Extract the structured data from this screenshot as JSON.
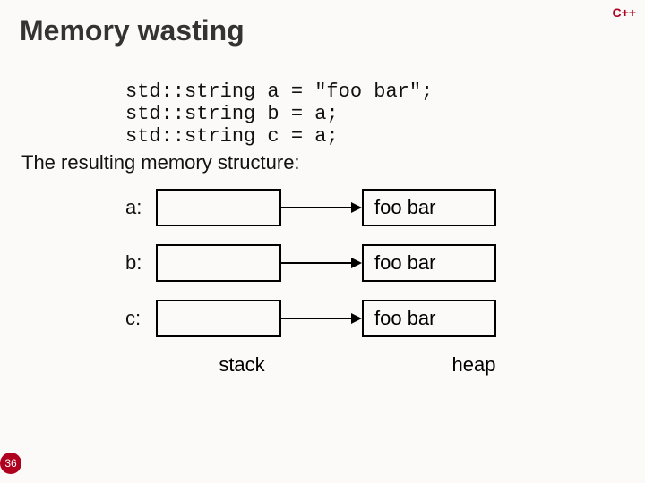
{
  "badge": "C++",
  "title": "Memory wasting",
  "code_line1": "std::string a = \"foo bar\";",
  "code_line2": "std::string b = a;",
  "code_line3": "std::string c = a;",
  "subtext": "The resulting memory structure:",
  "rows": [
    {
      "var": "a:",
      "heap": "foo bar"
    },
    {
      "var": "b:",
      "heap": "foo bar"
    },
    {
      "var": "c:",
      "heap": "foo bar"
    }
  ],
  "labels": {
    "stack": "stack",
    "heap": "heap"
  },
  "slide_number": "36"
}
